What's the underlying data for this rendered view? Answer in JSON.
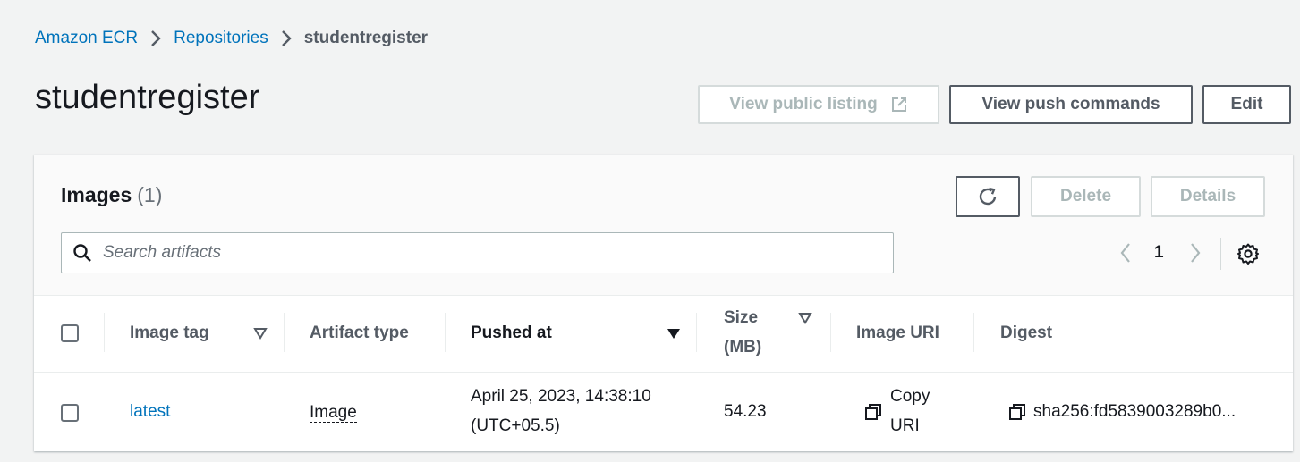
{
  "breadcrumb": {
    "items": [
      "Amazon ECR",
      "Repositories"
    ],
    "current": "studentregister"
  },
  "page": {
    "title": "studentregister"
  },
  "header_actions": {
    "view_public_listing": "View public listing",
    "view_push_commands": "View push commands",
    "edit": "Edit"
  },
  "images_panel": {
    "title": "Images",
    "count": "(1)",
    "delete": "Delete",
    "details": "Details",
    "search_placeholder": "Search artifacts",
    "current_page": "1"
  },
  "table": {
    "headers": {
      "image_tag": "Image tag",
      "artifact_type": "Artifact type",
      "pushed_at": "Pushed at",
      "size_line1": "Size",
      "size_line2": "(MB)",
      "image_uri": "Image URI",
      "digest": "Digest"
    },
    "rows": [
      {
        "image_tag": "latest",
        "artifact_type": "Image",
        "pushed_at_line1": "April 25, 2023, 14:38:10",
        "pushed_at_line2": "(UTC+05.5)",
        "size": "54.23",
        "copy_uri_line1": "Copy",
        "copy_uri_line2": "URI",
        "digest": "sha256:fd5839003289b0..."
      }
    ]
  },
  "colors": {
    "link": "#0073bb",
    "background": "#f2f3f3",
    "disabled": "#aab7b8"
  }
}
